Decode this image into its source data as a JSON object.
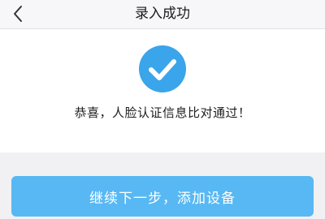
{
  "nav": {
    "title": "录入成功",
    "back_icon": "chevron-left-icon"
  },
  "result": {
    "icon": "check-circle-icon",
    "icon_color": "#3aa5ea",
    "message": "恭喜，人脸认证信息比对通过！"
  },
  "actions": {
    "primary_label": "继续下一步，添加设备",
    "primary_color": "#58b8f3"
  }
}
